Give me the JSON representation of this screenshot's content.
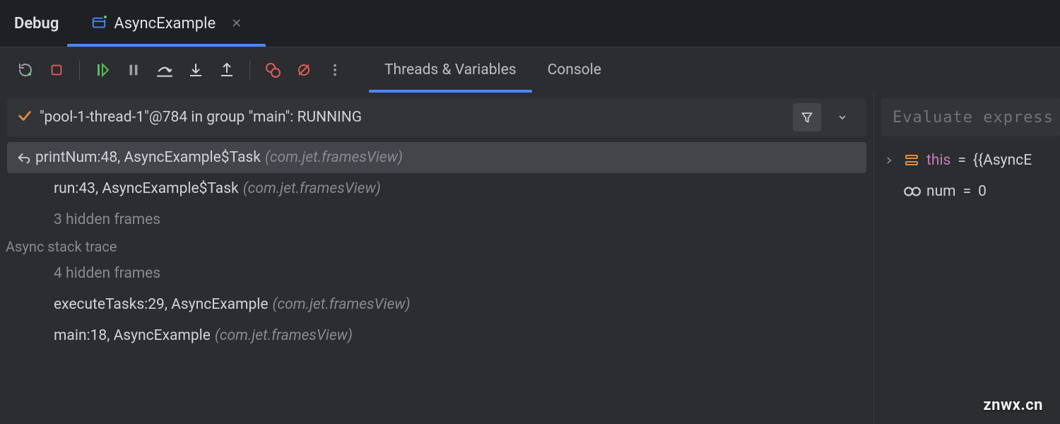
{
  "panel_title": "Debug",
  "file_tab": {
    "label": "AsyncExample"
  },
  "toolbar": {
    "tabs": {
      "threads": "Threads & Variables",
      "console": "Console"
    }
  },
  "thread_header": "\"pool-1-thread-1\"@784 in group \"main\": RUNNING",
  "frames": {
    "f0": {
      "main": "printNum:48, AsyncExample$Task",
      "pkg": "(com.jet.framesView)"
    },
    "f1": {
      "main": "run:43, AsyncExample$Task",
      "pkg": "(com.jet.framesView)"
    },
    "hidden1": "3 hidden frames",
    "group": "Async stack trace",
    "hidden2": "4 hidden frames",
    "f2": {
      "main": "executeTasks:29, AsyncExample",
      "pkg": "(com.jet.framesView)"
    },
    "f3": {
      "main": "main:18, AsyncExample",
      "pkg": "(com.jet.framesView)"
    }
  },
  "eval_placeholder": "Evaluate express",
  "vars": {
    "v0": {
      "name": "this",
      "val": "{AsyncE"
    },
    "v1": {
      "name": "num",
      "val": "0"
    }
  },
  "watermark": "znwx.cn"
}
